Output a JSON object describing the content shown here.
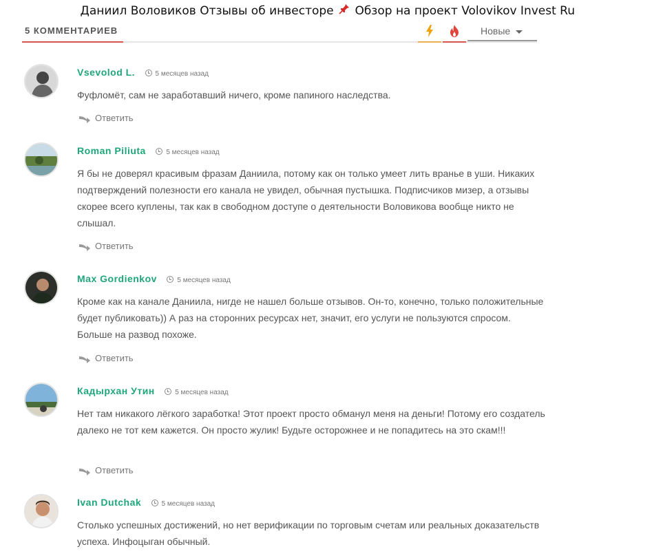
{
  "header": {
    "title_part1": "Даниил Воловиков Отзывы об инвесторе",
    "title_part2": "Обзор на проект Volovikov Invest Ru",
    "pin_icon": "pushpin-icon"
  },
  "comments_bar": {
    "count_label": "5 КОММЕНТАРИЕВ",
    "sort_hot_icon": "lightning-icon",
    "sort_popular_icon": "fire-icon",
    "sort_label": "Новые",
    "accent_colors": {
      "count": "#d9534f",
      "hot": "#f0ad4e",
      "popular": "#d9534f"
    }
  },
  "comments": [
    {
      "author": "Vsevolod L.",
      "time": "5 месяцев назад",
      "text": "Фуфломёт, сам не заработавший ничего, кроме папиного наследства.",
      "reply": "Ответить"
    },
    {
      "author": "Roman Piliuta",
      "time": "5 месяцев назад",
      "text": "Я бы не доверял красивым фразам Даниила, потому как он только умеет лить вранье в уши. Никаких подтверждений полезности его канала не увидел, обычная пустышка. Подписчиков мизер, а отзывы скорее всего куплены, так как в свободном доступе о деятельности Воловикова вообще никто не слышал.",
      "reply": "Ответить"
    },
    {
      "author": "Max Gordienkov",
      "time": "5 месяцев назад",
      "text": "Кроме как на канале Даниила, нигде не нашел больше отзывов. Он-то, конечно, только положительные будет публиковать)) А раз на сторонних ресурсах нет, значит, его услуги не пользуются спросом. Больше на развод похоже.",
      "reply": "Ответить"
    },
    {
      "author": "Кадырхан Утин",
      "time": "5 месяцев назад",
      "text": "Нет там никакого лёгкого заработка! Этот проект просто обманул меня на деньги! Потому его создатель далеко не тот кем кажется. Он просто жулик! Будьте осторожнее и не попадитесь на это скам!!!",
      "reply": "Ответить"
    },
    {
      "author": "Ivan Dutchak",
      "time": "5 месяцев назад",
      "text": "Столько успешных достижений, но нет верификации по торговым счетам или реальных доказательств успеха. Инфоцыган обычный.",
      "reply": ""
    }
  ]
}
